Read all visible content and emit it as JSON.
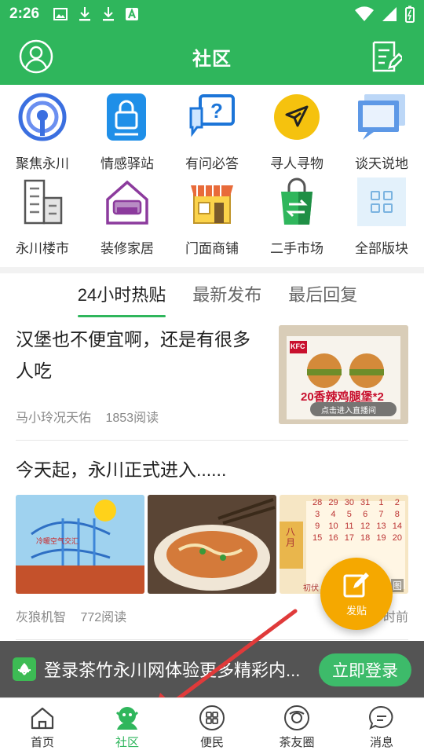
{
  "status_bar": {
    "time": "2:26"
  },
  "header": {
    "title": "社区"
  },
  "categories": [
    {
      "label": "聚焦永川",
      "icon": "broadcast-icon"
    },
    {
      "label": "情感驿站",
      "icon": "lock-card-icon"
    },
    {
      "label": "有问必答",
      "icon": "question-icon"
    },
    {
      "label": "寻人寻物",
      "icon": "send-icon"
    },
    {
      "label": "谈天说地",
      "icon": "chat-window-icon"
    },
    {
      "label": "永川楼市",
      "icon": "building-icon"
    },
    {
      "label": "装修家居",
      "icon": "sofa-icon"
    },
    {
      "label": "门面商铺",
      "icon": "shop-icon"
    },
    {
      "label": "二手市场",
      "icon": "shopping-bag-icon"
    },
    {
      "label": "全部版块",
      "icon": "grid-icon"
    }
  ],
  "tabs": [
    {
      "label": "24小时热贴",
      "active": true
    },
    {
      "label": "最新发布",
      "active": false
    },
    {
      "label": "最后回复",
      "active": false
    }
  ],
  "posts": [
    {
      "title": "汉堡也不便宜啊，还是有很多人吃",
      "author": "马小玲况天佑",
      "reads": "1853阅读",
      "thumb_text": {
        "brand": "KFC",
        "promo": "20香辣鸡腿堡*2",
        "hint": "点击进入直播间"
      }
    },
    {
      "title": "今天起，永川正式进入......",
      "author": "灰狼机智",
      "reads": "772阅读",
      "trailing": "时前",
      "thumb_text": {
        "weather": "冷暖空气交汇",
        "calendar_month": "八月",
        "calendar_numbers": [
          "28",
          "29",
          "30",
          "31",
          "1",
          "2",
          "3",
          "4",
          "5",
          "6",
          "7",
          "8",
          "9",
          "10",
          "11",
          "12",
          "13",
          "14",
          "15",
          "16",
          "17",
          "18",
          "19",
          "20"
        ],
        "more_label": "图",
        "calendar_tag": "初伏"
      }
    }
  ],
  "fab": {
    "label": "发贴"
  },
  "login_banner": {
    "text": "登录茶竹永川网体验更多精彩内...",
    "button": "立即登录",
    "behind_text": "首"
  },
  "bottom_nav": [
    {
      "label": "首页",
      "icon": "home-icon",
      "active": false
    },
    {
      "label": "社区",
      "icon": "community-icon",
      "active": true
    },
    {
      "label": "便民",
      "icon": "services-icon",
      "active": false
    },
    {
      "label": "茶友圈",
      "icon": "circle-icon",
      "active": false
    },
    {
      "label": "消息",
      "icon": "message-icon",
      "active": false
    }
  ],
  "colors": {
    "brand": "#2fb65c",
    "fab": "#f5a800",
    "arrow": "#e03a3a"
  }
}
